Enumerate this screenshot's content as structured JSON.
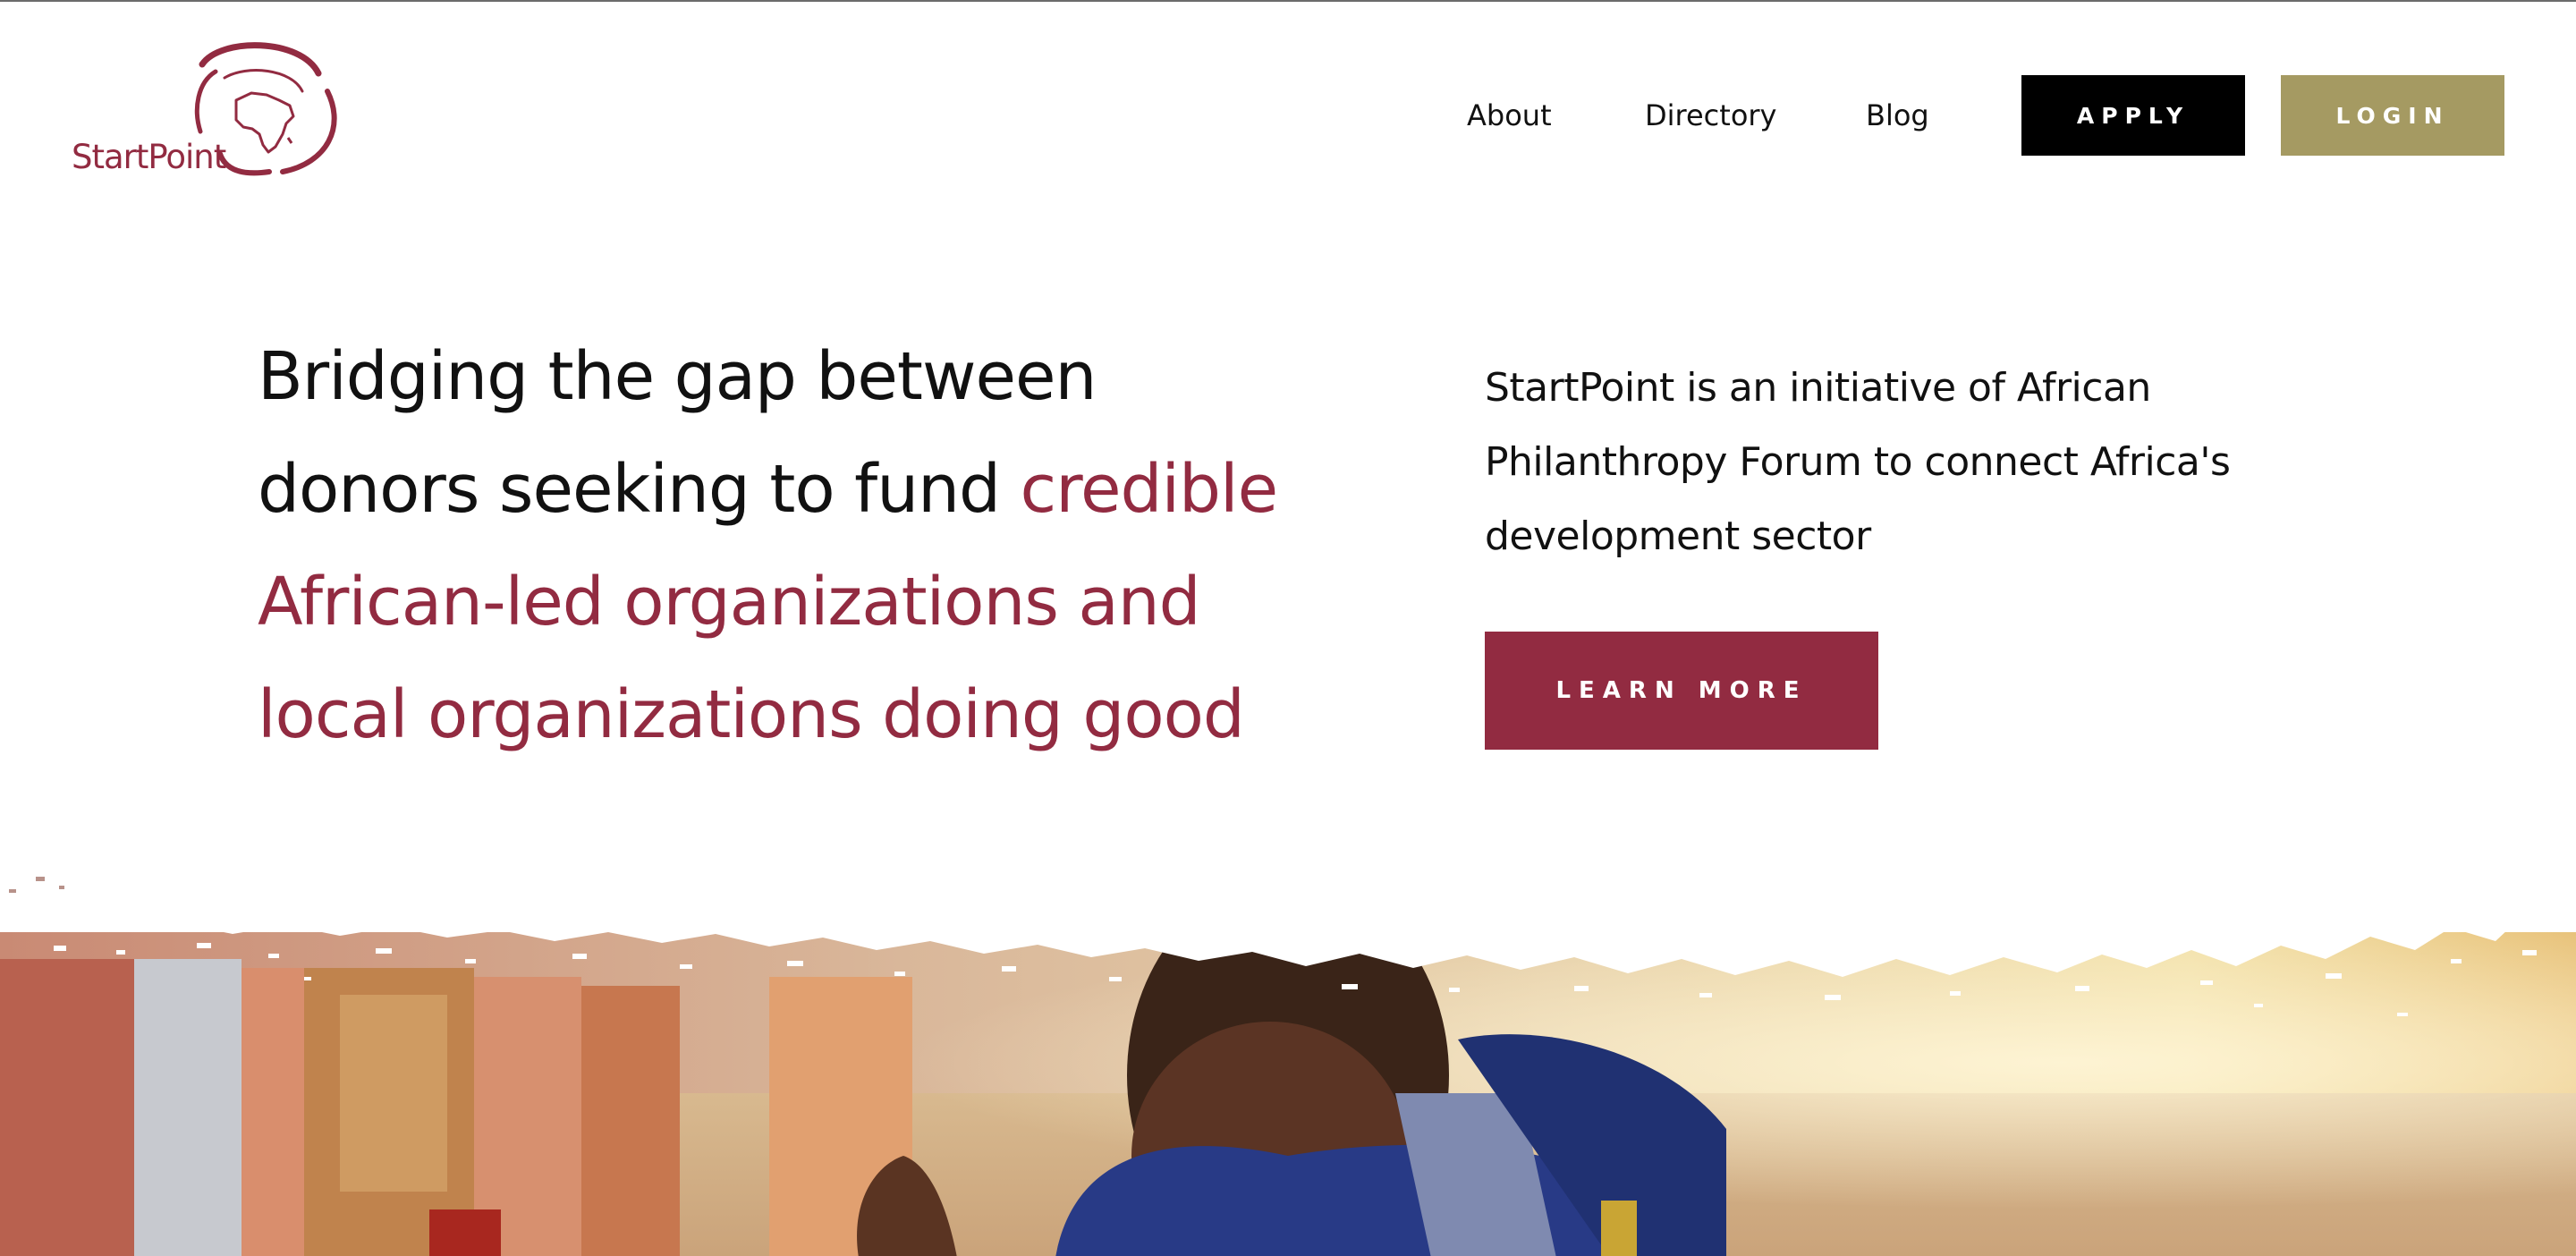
{
  "brand": {
    "name": "StartPoint",
    "logo_icon": "africa-swirl-logo",
    "color": "#922b41"
  },
  "nav": {
    "about": "About",
    "directory": "Directory",
    "blog": "Blog",
    "apply": "APPLY",
    "login": "LOGIN"
  },
  "hero": {
    "headline_line1": "Bridging the gap between",
    "headline_line2_plain": "donors seeking to fund",
    "headline_line2_accent": "credible",
    "headline_line3": "African-led organizations and",
    "headline_line4": "local organizations doing good",
    "intro_line1": "StartPoint is an initiative of African",
    "intro_line2": "Philanthropy Forum to connect Africa's",
    "intro_line3": "development sector",
    "cta": "LEARN MORE"
  },
  "colors": {
    "accent": "#922b41",
    "login_button": "#a59a62",
    "apply_button": "#000000"
  },
  "photo": {
    "icon": "hero-photo-woman-smiling"
  }
}
